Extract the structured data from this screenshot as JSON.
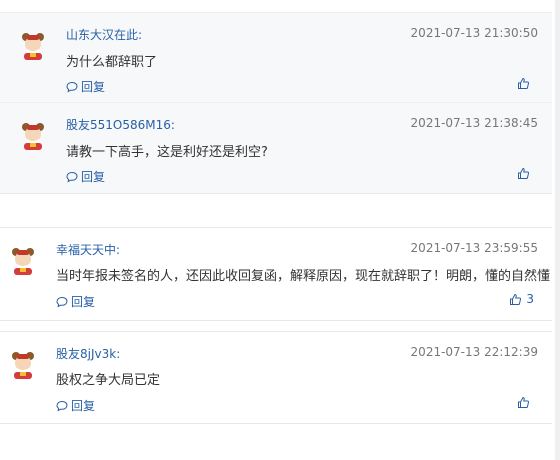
{
  "comments": [
    {
      "user": "山东大汉在此:",
      "time": "2021-07-13 21:30:50",
      "text": "为什么都辞职了",
      "reply_label": "回复",
      "likes": ""
    },
    {
      "user": "股友551O586M16:",
      "time": "2021-07-13 21:38:45",
      "text": "请教一下高手，这是利好还是利空?",
      "reply_label": "回复",
      "likes": ""
    },
    {
      "user": "幸福天天中:",
      "time": "2021-07-13 23:59:55",
      "text": "当时年报未签名的人，还因此收回复函，解释原因，现在就辞职了！明朗，懂的自然懂",
      "reply_label": "回复",
      "likes": "3"
    },
    {
      "user": "股友8jJv3k:",
      "time": "2021-07-13 22:12:39",
      "text": "股权之争大局已定",
      "reply_label": "回复",
      "likes": ""
    }
  ],
  "colors": {
    "link": "#2860a6",
    "reply_bg": "#f7f8fa"
  },
  "icons": {
    "avatar": "fortune-god-avatar",
    "reply": "comment-bubble-icon",
    "like": "thumbs-up-icon"
  }
}
